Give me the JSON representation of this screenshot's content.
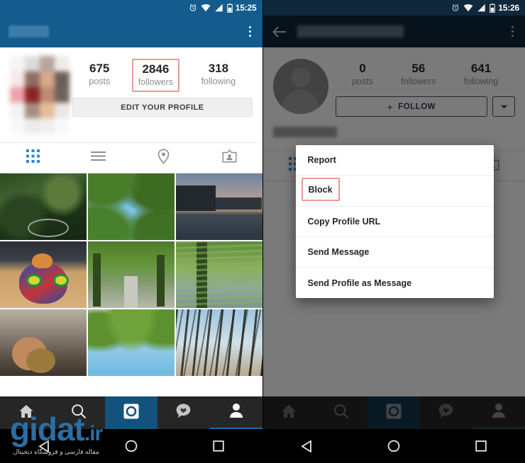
{
  "meta": {
    "colors": {
      "appbar_blue": "#145c8e",
      "accent_blue": "#1b6ea8",
      "highlight_red": "#e89a9a",
      "nav_dark": "#262626",
      "scrim": "rgba(0,0,0,0.52)"
    }
  },
  "left_panel": {
    "statusbar": {
      "time": "15:25",
      "icons": [
        "alarm-icon",
        "wifi-icon",
        "signal-icon",
        "battery-icon"
      ]
    },
    "appbar": {
      "title_redacted": "",
      "overflow_icon": "kebab-menu-icon"
    },
    "profile": {
      "avatar": "blurred-profile-photo",
      "stats": [
        {
          "num": "675",
          "label": "posts",
          "highlighted": false
        },
        {
          "num": "2846",
          "label": "followers",
          "highlighted": true
        },
        {
          "num": "318",
          "label": "following",
          "highlighted": false
        }
      ],
      "edit_button": "EDIT YOUR PROFILE"
    },
    "tabs": [
      {
        "name": "grid-tab",
        "icon": "grid-icon",
        "active": true
      },
      {
        "name": "list-tab",
        "icon": "list-icon",
        "active": false
      },
      {
        "name": "map-tab",
        "icon": "location-pin-icon",
        "active": false
      },
      {
        "name": "tagged-tab",
        "icon": "tagged-photos-icon",
        "active": false
      }
    ],
    "grid_photos": [
      "trees-over-canal-with-bicycle",
      "green-leaves-against-blue-sky",
      "river-at-dusk-with-buildings",
      "colorful-butterfly-kite-on-boat",
      "tree-lined-path",
      "willow-tree-over-water",
      "hand-holding-object",
      "canopy-of-green-leaves",
      "bare-trees-against-sky"
    ],
    "bottom_nav": [
      {
        "name": "home-tab",
        "icon": "home-icon",
        "active": false
      },
      {
        "name": "search-tab",
        "icon": "search-icon",
        "active": false
      },
      {
        "name": "camera-tab",
        "icon": "camera-icon",
        "active": true
      },
      {
        "name": "activity-tab",
        "icon": "heart-chat-icon",
        "active": false
      },
      {
        "name": "profile-tab",
        "icon": "person-icon",
        "active": false,
        "selected": true
      }
    ],
    "system_nav": [
      {
        "name": "back-button",
        "icon": "triangle-back-icon"
      },
      {
        "name": "home-button",
        "icon": "circle-home-icon"
      },
      {
        "name": "recents-button",
        "icon": "square-recents-icon"
      }
    ]
  },
  "right_panel": {
    "statusbar": {
      "time": "15:26",
      "icons": [
        "alarm-icon",
        "wifi-icon",
        "signal-icon",
        "battery-icon"
      ]
    },
    "appbar": {
      "back_icon": "back-arrow-icon",
      "title_redacted": "",
      "overflow_icon": "kebab-menu-icon"
    },
    "profile": {
      "avatar": "default-person-avatar",
      "stats": [
        {
          "num": "0",
          "label": "posts"
        },
        {
          "num": "56",
          "label": "followers"
        },
        {
          "num": "641",
          "label": "following"
        }
      ],
      "follow_button": "FOLLOW",
      "follow_plus": "+",
      "dropdown_icon": "chevron-down-icon"
    },
    "dialog": {
      "items": [
        {
          "label": "Report",
          "highlighted": false
        },
        {
          "label": "Block",
          "highlighted": true
        },
        {
          "label": "Copy Profile URL",
          "highlighted": false
        },
        {
          "label": "Send Message",
          "highlighted": false
        },
        {
          "label": "Send Profile as Message",
          "highlighted": false
        }
      ]
    },
    "bottom_nav": [
      {
        "name": "home-tab",
        "icon": "home-icon",
        "active": false
      },
      {
        "name": "search-tab",
        "icon": "search-icon",
        "active": false
      },
      {
        "name": "camera-tab",
        "icon": "camera-icon",
        "active": true
      },
      {
        "name": "activity-tab",
        "icon": "heart-chat-icon",
        "active": false
      },
      {
        "name": "profile-tab",
        "icon": "person-icon",
        "active": false,
        "selected": true
      }
    ],
    "system_nav": [
      {
        "name": "back-button",
        "icon": "triangle-back-icon"
      },
      {
        "name": "home-button",
        "icon": "circle-home-icon"
      },
      {
        "name": "recents-button",
        "icon": "square-recents-icon"
      }
    ]
  },
  "watermark": {
    "text": "gidat",
    "tld": ".ir",
    "subtitle": "مقاله فارسی و فروشگاه دیجیتال"
  }
}
